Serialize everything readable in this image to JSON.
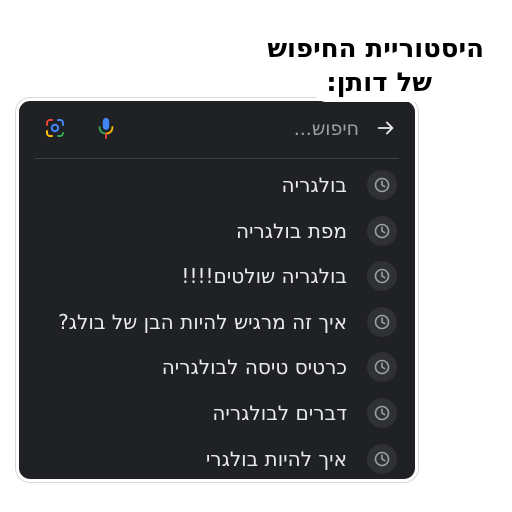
{
  "caption": {
    "line1": "היסטוריית החיפוש",
    "line2": "של דותן:"
  },
  "search": {
    "placeholder": "חיפוש...",
    "back_icon": "arrow-right-icon",
    "mic_icon": "microphone-icon",
    "lens_icon": "google-lens-icon"
  },
  "history": [
    {
      "text": "בולגריה",
      "icon": "history-clock-icon"
    },
    {
      "text": "מפת בולגריה",
      "icon": "history-clock-icon"
    },
    {
      "text": "בולגריה שולטים!!!!",
      "icon": "history-clock-icon"
    },
    {
      "text": "איך זה מרגיש להיות הבן של בולג?",
      "icon": "history-clock-icon"
    },
    {
      "text": "כרטיס טיסה לבולגריה",
      "icon": "history-clock-icon"
    },
    {
      "text": "דברים לבולגריה",
      "icon": "history-clock-icon"
    },
    {
      "text": "איך להיות בולגרי",
      "icon": "history-clock-icon"
    }
  ],
  "colors": {
    "panel_background": "#202124",
    "text": "#e8eaed",
    "placeholder": "#9aa0a6",
    "google_blue": "#4285f4",
    "google_red": "#ea4335",
    "google_yellow": "#fbbc04",
    "google_green": "#34a853"
  }
}
